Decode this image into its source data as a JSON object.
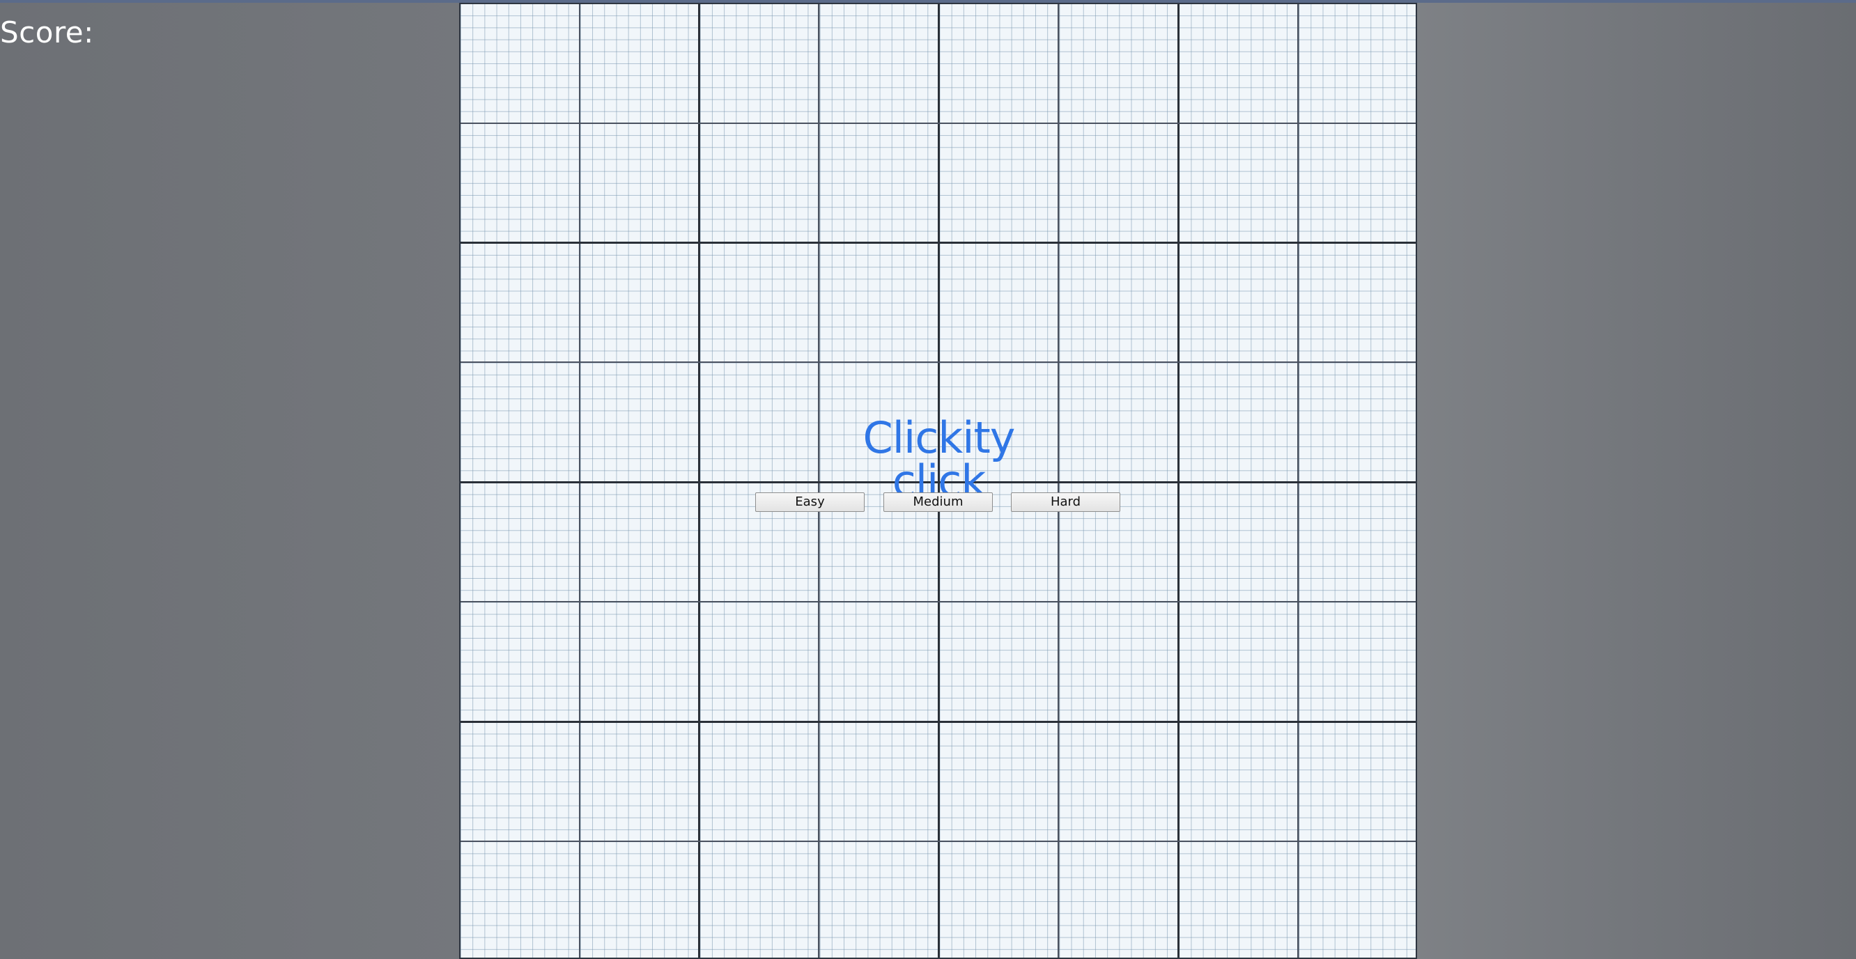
{
  "hud": {
    "score_label": "Score:"
  },
  "game": {
    "title": "Clickity click",
    "title_color": "#2f76e6"
  },
  "difficulty": {
    "easy_label": "Easy",
    "medium_label": "Medium",
    "hard_label": "Hard"
  },
  "board": {
    "paper_color": "#f1f6fa",
    "major_line_color": "#2a3038",
    "minor_line_color": "#7896af"
  }
}
